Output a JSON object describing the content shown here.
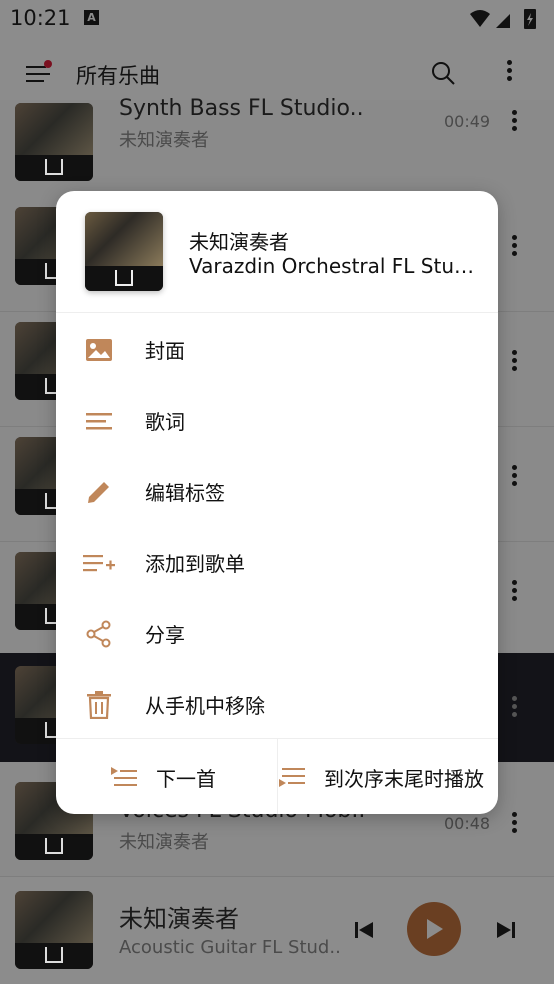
{
  "status_bar": {
    "time": "10:21",
    "notification_icon": "A"
  },
  "app_bar": {
    "title": "所有乐曲"
  },
  "list": [
    {
      "title": "Synth Bass FL Studio..",
      "artist": "未知演奏者",
      "duration": "00:49"
    },
    {
      "title": "",
      "artist": "",
      "duration": ""
    },
    {
      "title": "",
      "artist": "",
      "duration": ""
    },
    {
      "title": "",
      "artist": "",
      "duration": ""
    },
    {
      "title": "",
      "artist": "",
      "duration": ""
    },
    {
      "title": "",
      "artist": "",
      "duration": "",
      "playing": true
    },
    {
      "title": "Voices FL Studio Mob..",
      "artist": "未知演奏者",
      "duration": "00:48"
    }
  ],
  "mini_player": {
    "artist": "未知演奏者",
    "title": "Acoustic Guitar FL Stud.."
  },
  "dialog": {
    "artist": "未知演奏者",
    "title": "Varazdin Orchestral FL Studio Mobile",
    "menu": [
      {
        "icon": "image-icon",
        "label": "封面"
      },
      {
        "icon": "lyrics-icon",
        "label": "歌词"
      },
      {
        "icon": "pencil-icon",
        "label": "编辑标签"
      },
      {
        "icon": "playlist-add-icon",
        "label": "添加到歌单"
      },
      {
        "icon": "share-icon",
        "label": "分享"
      },
      {
        "icon": "trash-icon",
        "label": "从手机中移除"
      }
    ],
    "play_next_label": "下一首",
    "play_last_label": "到次序末尾时播放"
  },
  "colors": {
    "accent": "#c0875a",
    "scrim": "#8a8a8a",
    "playing_row": "#131318",
    "play_button": "#6a3f22"
  }
}
